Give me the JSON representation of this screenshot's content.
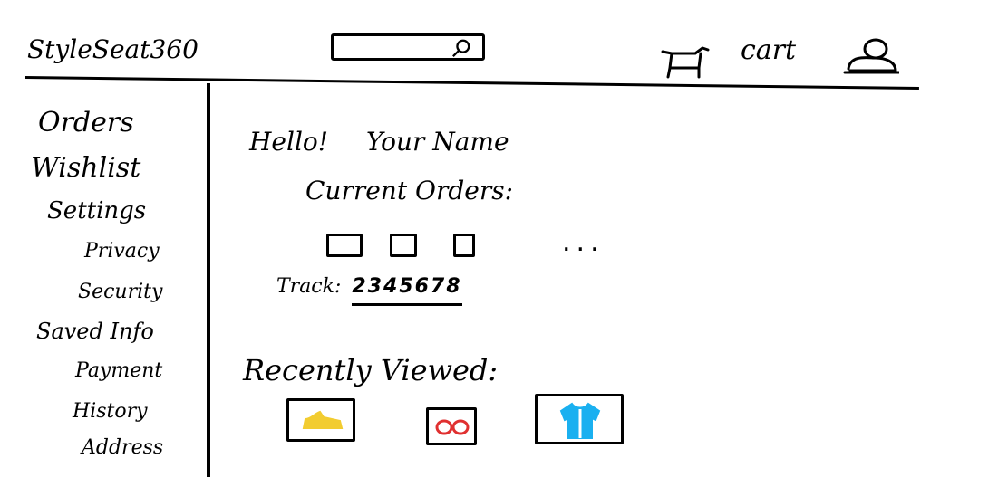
{
  "header": {
    "brand": "StyleSeat360",
    "cart_label": "cart",
    "icons": {
      "search": "search-icon",
      "cart": "cart-icon",
      "user": "user-icon"
    }
  },
  "sidebar": {
    "items": [
      {
        "label": "Orders"
      },
      {
        "label": "Wishlist"
      },
      {
        "label": "Settings"
      },
      {
        "label": "Privacy"
      },
      {
        "label": "Security"
      },
      {
        "label": "Saved Info"
      },
      {
        "label": "Payment"
      },
      {
        "label": "History"
      },
      {
        "label": "Address"
      }
    ]
  },
  "main": {
    "greeting": "Hello!",
    "greeting_name": "Your Name",
    "current_orders_heading": "Current Orders:",
    "more_indicator": "...",
    "tracking_label": "Track:",
    "tracking_number": "2345678",
    "recently_viewed_heading": "Recently Viewed:",
    "recent_items": [
      {
        "icon": "shoe-icon",
        "color": "#f2cc30"
      },
      {
        "icon": "glasses-icon",
        "color": "#e03030"
      },
      {
        "icon": "shirt-icon",
        "color": "#1ab0f0"
      }
    ]
  }
}
